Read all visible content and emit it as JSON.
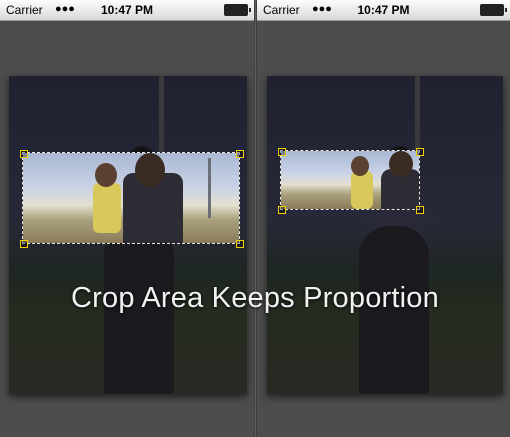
{
  "screens": [
    {
      "status": {
        "carrier": "Carrier",
        "time": "10:47 PM"
      }
    },
    {
      "status": {
        "carrier": "Carrier",
        "time": "10:47 PM"
      }
    }
  ],
  "caption": "Crop Area Keeps Proportion",
  "colors": {
    "crop_handle": "#f0d000",
    "overlay": "#4d4d4d"
  }
}
